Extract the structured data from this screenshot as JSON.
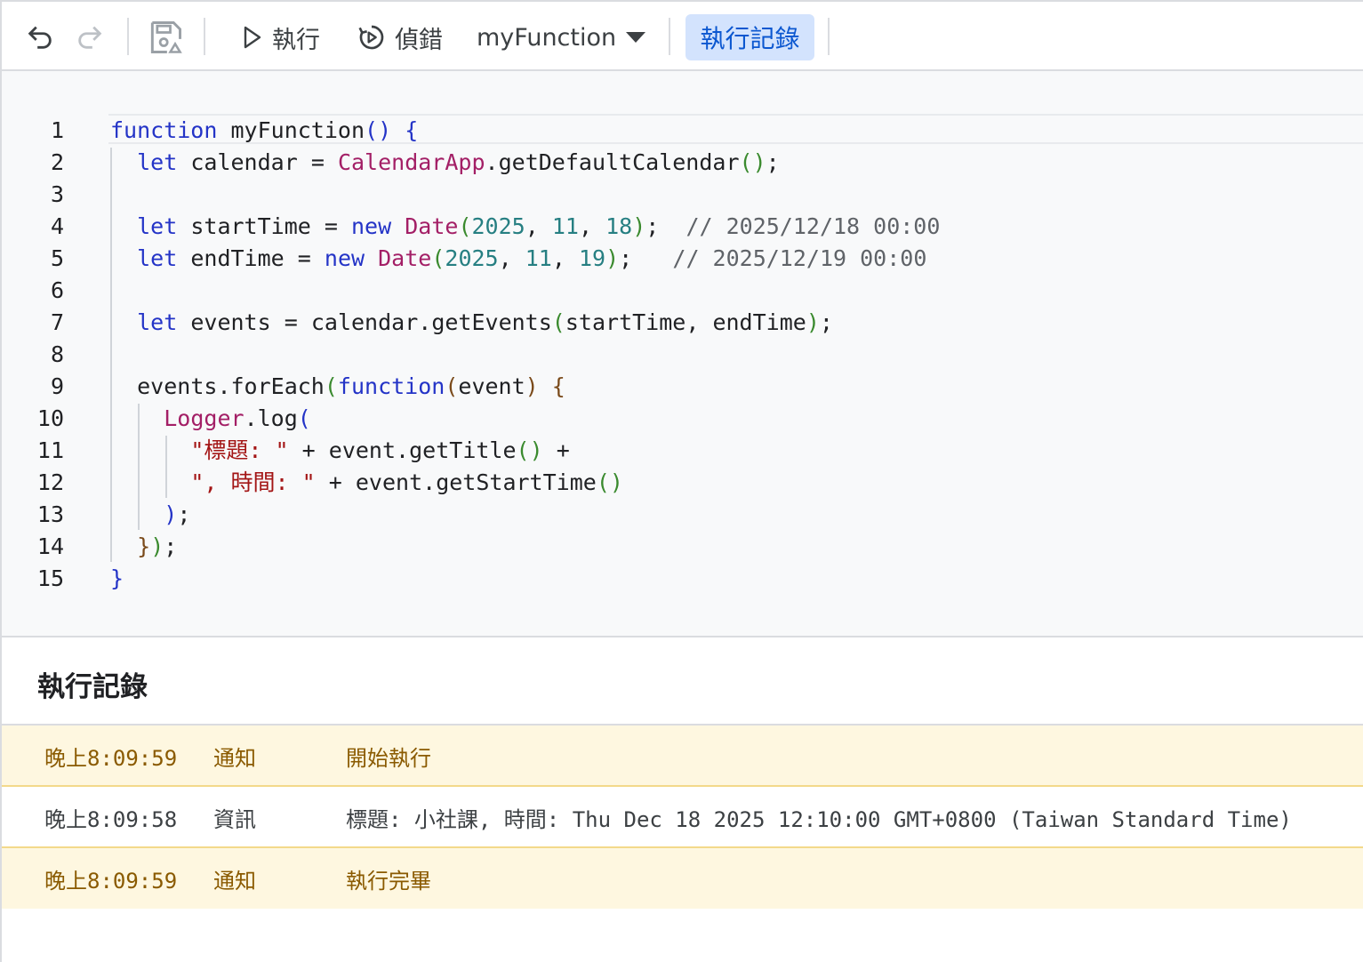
{
  "toolbar": {
    "undo_icon": "undo-icon",
    "redo_icon": "redo-icon",
    "save_icon": "save-to-drive-icon",
    "run_label": "執行",
    "debug_label": "偵錯",
    "function_select": "myFunction",
    "execution_log_label": "執行記錄",
    "colors": {
      "active_bg": "#d3e3fd",
      "active_text": "#0b57d0"
    }
  },
  "editor": {
    "line_numbers": [
      "1",
      "2",
      "3",
      "4",
      "5",
      "6",
      "7",
      "8",
      "9",
      "10",
      "11",
      "12",
      "13",
      "14",
      "15"
    ],
    "code_lines": [
      "function myFunction() {",
      "  let calendar = CalendarApp.getDefaultCalendar();",
      "",
      "  let startTime = new Date(2025, 11, 18);  // 2025/12/18 00:00",
      "  let endTime = new Date(2025, 11, 19);   // 2025/12/19 00:00",
      "",
      "  let events = calendar.getEvents(startTime, endTime);",
      "",
      "  events.forEach(function(event) {",
      "    Logger.log(",
      "      \"標題: \" + event.getTitle() +",
      "      \", 時間: \" + event.getStartTime()",
      "    );",
      "  });",
      "}"
    ]
  },
  "log_panel": {
    "title": "執行記錄",
    "rows": [
      {
        "time": "晚上8:09:59",
        "level": "通知",
        "message": "開始執行",
        "type": "notice"
      },
      {
        "time": "晚上8:09:58",
        "level": "資訊",
        "message": "標題: 小社課, 時間: Thu Dec 18 2025 12:10:00 GMT+0800 (Taiwan Standard Time)",
        "type": "info"
      },
      {
        "time": "晚上8:09:59",
        "level": "通知",
        "message": "執行完畢",
        "type": "notice"
      }
    ],
    "colors": {
      "notice_bg": "#fef7e0",
      "notice_text": "#8a5a00",
      "info_text": "#3c4043"
    }
  }
}
